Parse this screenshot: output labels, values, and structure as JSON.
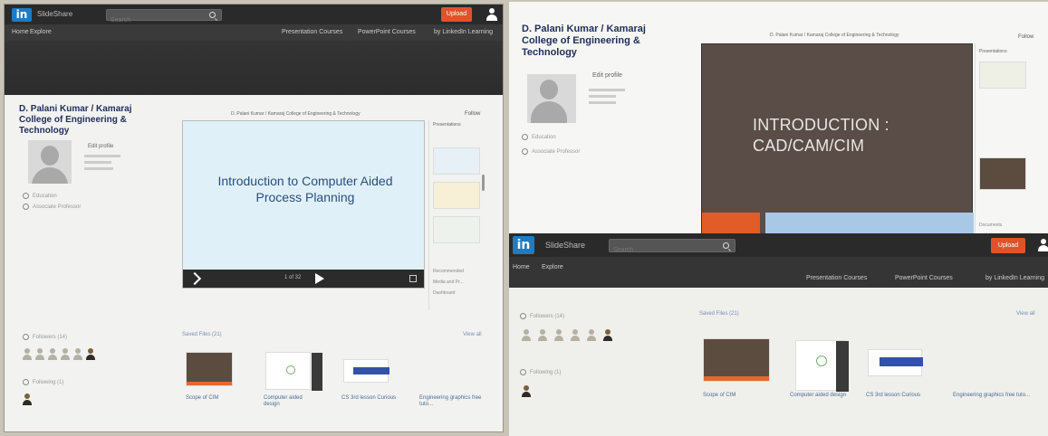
{
  "left": {
    "logo": "in",
    "brand": "SlideShare",
    "search_placeholder": "Search",
    "upload": "Upload",
    "nav_left": [
      "Home",
      "Explore"
    ],
    "nav_right": [
      "Presentation Courses",
      "PowerPoint Courses",
      "by LinkedIn Learning"
    ],
    "author_name": "D. Palani Kumar / Kamaraj College of Engineering & Technology",
    "edit_profile": "Edit profile",
    "radio_items": [
      "Education",
      "Associate Professor"
    ],
    "slide_header": "D. Palani Kumar / Kamaraj College of Engineering & Technology",
    "follow": "Follow",
    "slide_text": "Introduction to Computer Aided Process Planning",
    "pager": "1 of 32",
    "sidebar": {
      "title": "Presentations",
      "links": [
        "Recommended",
        "Media and Pr...",
        "Dashboard"
      ]
    },
    "followers": "Followers (14)",
    "following": "Following (1)",
    "saved": "Saved Files (21)",
    "view_all": "View all",
    "cards": [
      {
        "title": "Scope of CIM"
      },
      {
        "title": "Computer aided design"
      },
      {
        "title": "CS 3rd lesson Curious"
      },
      {
        "title": "Engineering graphics free tuto..."
      }
    ]
  },
  "right_top": {
    "author_name": "D. Palani Kumar / Kamaraj College of Engineering & Technology",
    "edit_profile": "Edit profile",
    "slide_header": "D. Palani Kumar / Kamaraj College of Engineering & Technology",
    "follow": "Follow",
    "slide_text": "INTRODUCTION : CAD/CAM/CIM",
    "radio_items": [
      "Education",
      "Associate Professor"
    ],
    "sidebar_title": "Presentations",
    "documents": "Documents"
  },
  "right_bottom": {
    "logo": "in",
    "brand": "SlideShare",
    "search_placeholder": "Search",
    "upload": "Upload",
    "nav_left": [
      "Home",
      "Explore"
    ],
    "nav_right": [
      "Presentation Courses",
      "PowerPoint Courses",
      "by LinkedIn Learning"
    ],
    "followers": "Followers (14)",
    "following": "Following (1)",
    "saved": "Saved Files (21)",
    "view_all": "View all",
    "cards": [
      {
        "title": "Scope of CIM"
      },
      {
        "title": "Computer aided design"
      },
      {
        "title": "CS 3rd lesson Curious"
      },
      {
        "title": "Engineering graphics free tuto..."
      }
    ]
  }
}
